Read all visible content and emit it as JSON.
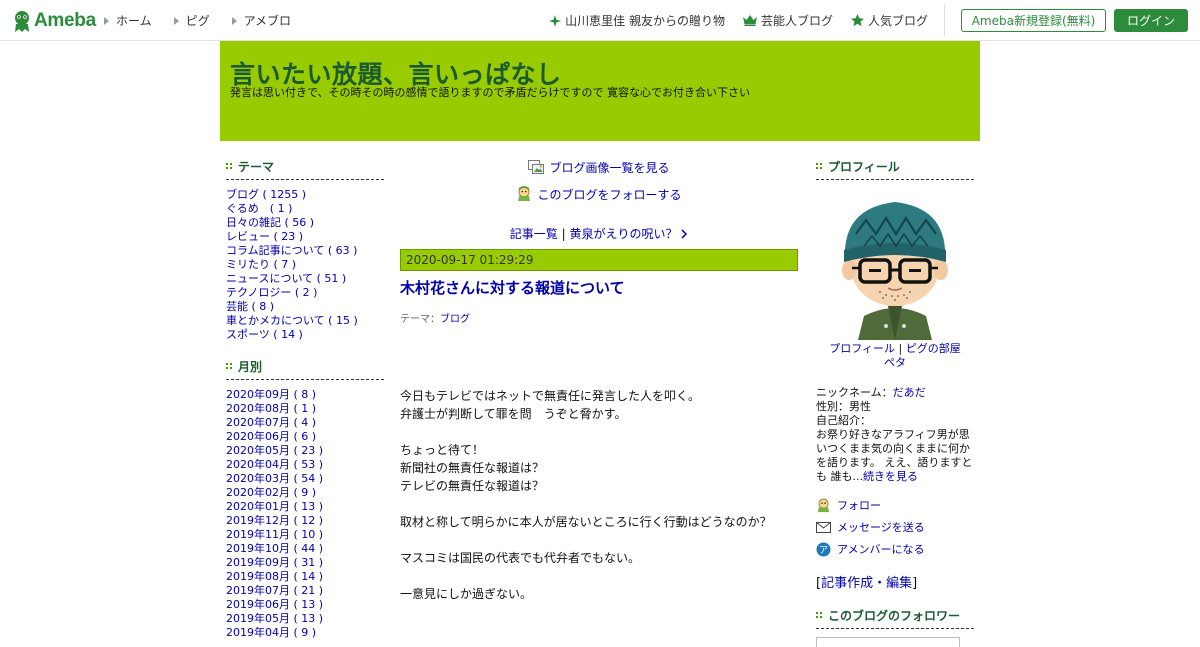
{
  "header": {
    "logo_text": "Ameba",
    "nav": [
      "ホーム",
      "ピグ",
      "アメブロ"
    ],
    "right_links": [
      {
        "icon": "sparkle-icon",
        "label": "山川恵里佳 親友からの贈り物"
      },
      {
        "icon": "crown-icon",
        "label": "芸能人ブログ"
      },
      {
        "icon": "star-icon",
        "label": "人気ブログ"
      }
    ],
    "signup_label": "Ameba新規登録(無料)",
    "login_label": "ログイン"
  },
  "blog": {
    "title": "言いたい放題、言いっぱなし",
    "description": "発言は思い付きで、その時その時の感情で語りますので矛盾だらけですので 寛容な心でお付き合い下さい"
  },
  "sidebar_left": {
    "theme_title": "テーマ",
    "themes": [
      "ブログ ( 1255 )",
      "ぐるめ　( 1 )",
      "日々の雑記 ( 56 )",
      "レビュー ( 23 )",
      "コラム記事について ( 63 )",
      "ミリたり ( 7 )",
      "ニュースについて ( 51 )",
      "テクノロジー ( 2 )",
      "芸能 ( 8 )",
      "車とかメカについて ( 15 )",
      "スポーツ ( 14 )"
    ],
    "monthly_title": "月別",
    "months": [
      "2020年09月 ( 8 )",
      "2020年08月 ( 1 )",
      "2020年07月 ( 4 )",
      "2020年06月 ( 6 )",
      "2020年05月 ( 23 )",
      "2020年04月 ( 53 )",
      "2020年03月 ( 54 )",
      "2020年02月 ( 9 )",
      "2020年01月 ( 13 )",
      "2019年12月 ( 12 )",
      "2019年11月 ( 10 )",
      "2019年10月 ( 44 )",
      "2019年09月 ( 31 )",
      "2019年08月 ( 14 )",
      "2019年07月 ( 21 )",
      "2019年06月 ( 13 )",
      "2019年05月 ( 13 )",
      "2019年04月 ( 9 )"
    ]
  },
  "main": {
    "image_list_link": "ブログ画像一覧を見る",
    "follow_link": "このブログをフォローする",
    "nav_list": "記事一覧",
    "nav_sep": "|",
    "nav_next": "黄泉がえりの呪い？",
    "entry": {
      "date": "2020-09-17 01:29:29",
      "title": "木村花さんに対する報道について",
      "theme_label": "テーマ：",
      "theme_value": "ブログ",
      "body": [
        "今日もテレビではネットで無責任に発言した人を叩く。",
        "弁護士が判断して罪を問　うぞと脅かす。",
        "",
        "ちょっと待て！",
        "新聞社の無責任な報道は？",
        "テレビの無責任な報道は？",
        "",
        "取材と称して明らかに本人が居ないところに行く行動はどうなのか？",
        "",
        "マスコミは国民の代表でも代弁者でもない。",
        "",
        "一意見にしか過ぎない。"
      ]
    }
  },
  "sidebar_right": {
    "profile_title": "プロフィール",
    "profile_link": "プロフィール",
    "pig_link": "ピグの部屋",
    "peta": "ペタ",
    "nickname_label": "ニックネーム：",
    "nickname": "だあだ",
    "gender": "性別：男性",
    "intro_label": "自己紹介：",
    "intro_text": "お祭り好きなアラフィフ男が思いつくまま気の向くままに何かを語ります。 ええ、語りますとも 誰も...",
    "read_more": "続きを見る",
    "follow": "フォロー",
    "message": "メッセージを送る",
    "amember": "アメンバーになる",
    "edit_open": "[",
    "edit_create": "記事作成",
    "edit_sep": "・",
    "edit_edit": "編集",
    "edit_close": "]",
    "followers_title": "このブログのフォロワー"
  }
}
